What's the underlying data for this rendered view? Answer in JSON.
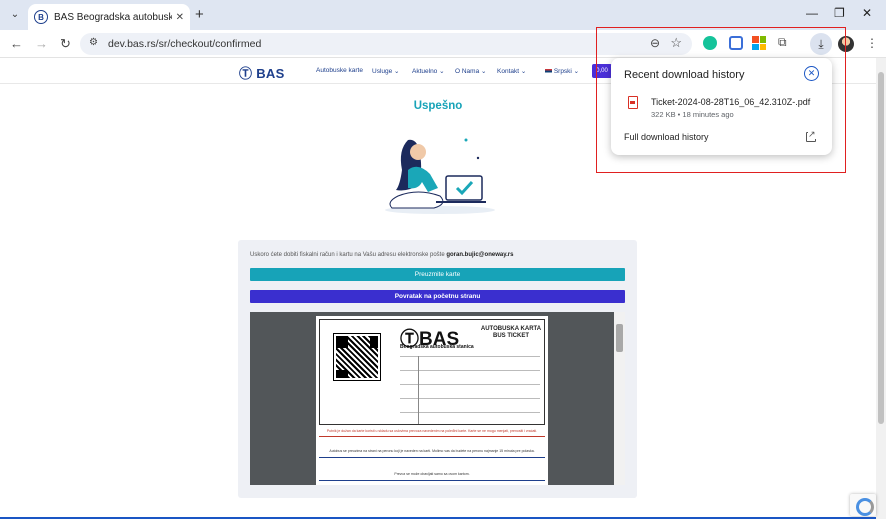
{
  "browser": {
    "tab_title": "BAS   Beogradska autobuska st",
    "new_tab": "+",
    "url": "dev.bas.rs/sr/checkout/confirmed",
    "window_controls": {
      "minimize": "—",
      "restore": "❐",
      "close": "✕"
    }
  },
  "site": {
    "logo": "BAS",
    "nav": [
      "Autobuske karte",
      "Usluge ⌄",
      "Aktuelno ⌄",
      "O Nama ⌄",
      "Kontakt ⌄",
      "Srpski ⌄"
    ],
    "nav_cta": "0,00"
  },
  "page": {
    "title": "Uspešno",
    "info_text": "Uskoro ćete dobiti fiskalni račun i kartu na Vašu adresu elektronske pošte",
    "email": "goran.bujic@oneway.rs",
    "download_button": "Preuzmite karte",
    "home_button": "Povratak na početnu stranu"
  },
  "ticket": {
    "logo": "BAS",
    "subtitle": "Beogradska autobuska stanica",
    "title_line1": "AUTOBUSKA KARTA",
    "title_line2": "BUS TICKET",
    "red_note": "Putnik je dužan da karte koristi u skladu sa uslovima prevoza navedenim na poleđini karte. Karte se ne mogu menjati, prenositi i vraćati.",
    "blue_note": "Autobus se preuzima na strani na peronu koji je naveden na karti. Molimo vas da budete na peronu najmanje 15 minuta pre polaska.",
    "last_note": "Prevoz se može obavljati samo sa ovom kartom."
  },
  "download_popup": {
    "title": "Recent download history",
    "file_name": "Ticket-2024-08-28T16_06_42.310Z-.pdf",
    "file_meta": "322 KB • 18 minutes ago",
    "full_history": "Full download history"
  }
}
